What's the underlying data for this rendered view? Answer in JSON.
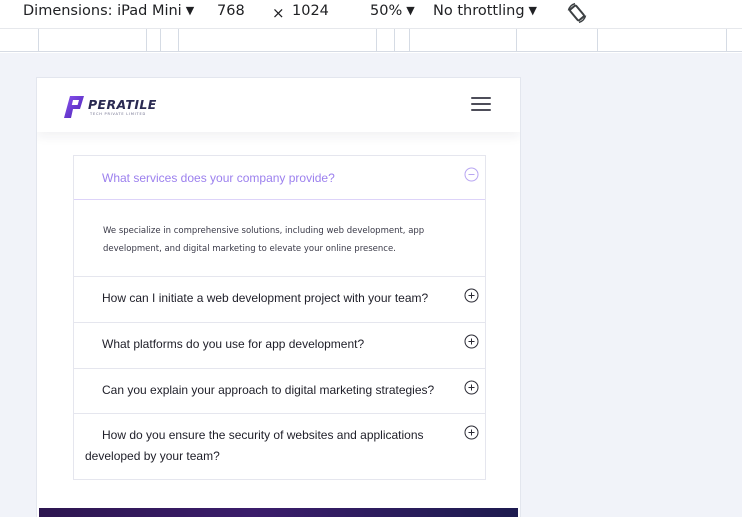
{
  "devtools": {
    "dimensions_label": "Dimensions: iPad Mini",
    "width_value": "768",
    "times_symbol": "×",
    "height_value": "1024",
    "zoom_value": "50%",
    "throttling_value": "No throttling",
    "caret": "▼",
    "rotate_icon": "rotate-icon"
  },
  "site": {
    "logo_text": "PERATILE",
    "logo_tagline": "TECH PRIVATE LIMITED",
    "logo_icon": "logo-icon",
    "menu_icon": "hamburger-menu-icon"
  },
  "faq": {
    "items": [
      {
        "question": "What services does your company provide?",
        "answer": "We specialize in comprehensive solutions, including web development, app development, and digital marketing to elevate your online presence.",
        "expanded": true,
        "icon": "minus-circle-icon"
      },
      {
        "question": "How can I initiate a web development project with your team?",
        "expanded": false,
        "icon": "plus-circle-icon"
      },
      {
        "question": "What platforms do you use for app development?",
        "expanded": false,
        "icon": "plus-circle-icon"
      },
      {
        "question": "Can you explain your approach to digital marketing strategies?",
        "expanded": false,
        "icon": "plus-circle-icon"
      },
      {
        "question": "How do you ensure the security of websites and applications developed by your team?",
        "expanded": false,
        "icon": "plus-circle-icon"
      }
    ]
  },
  "colors": {
    "accent": "#9c80ee",
    "logo_purple": "#6b3bd6",
    "hero_dark": "#2d1650",
    "workspace_bg": "#f1f3f9"
  }
}
